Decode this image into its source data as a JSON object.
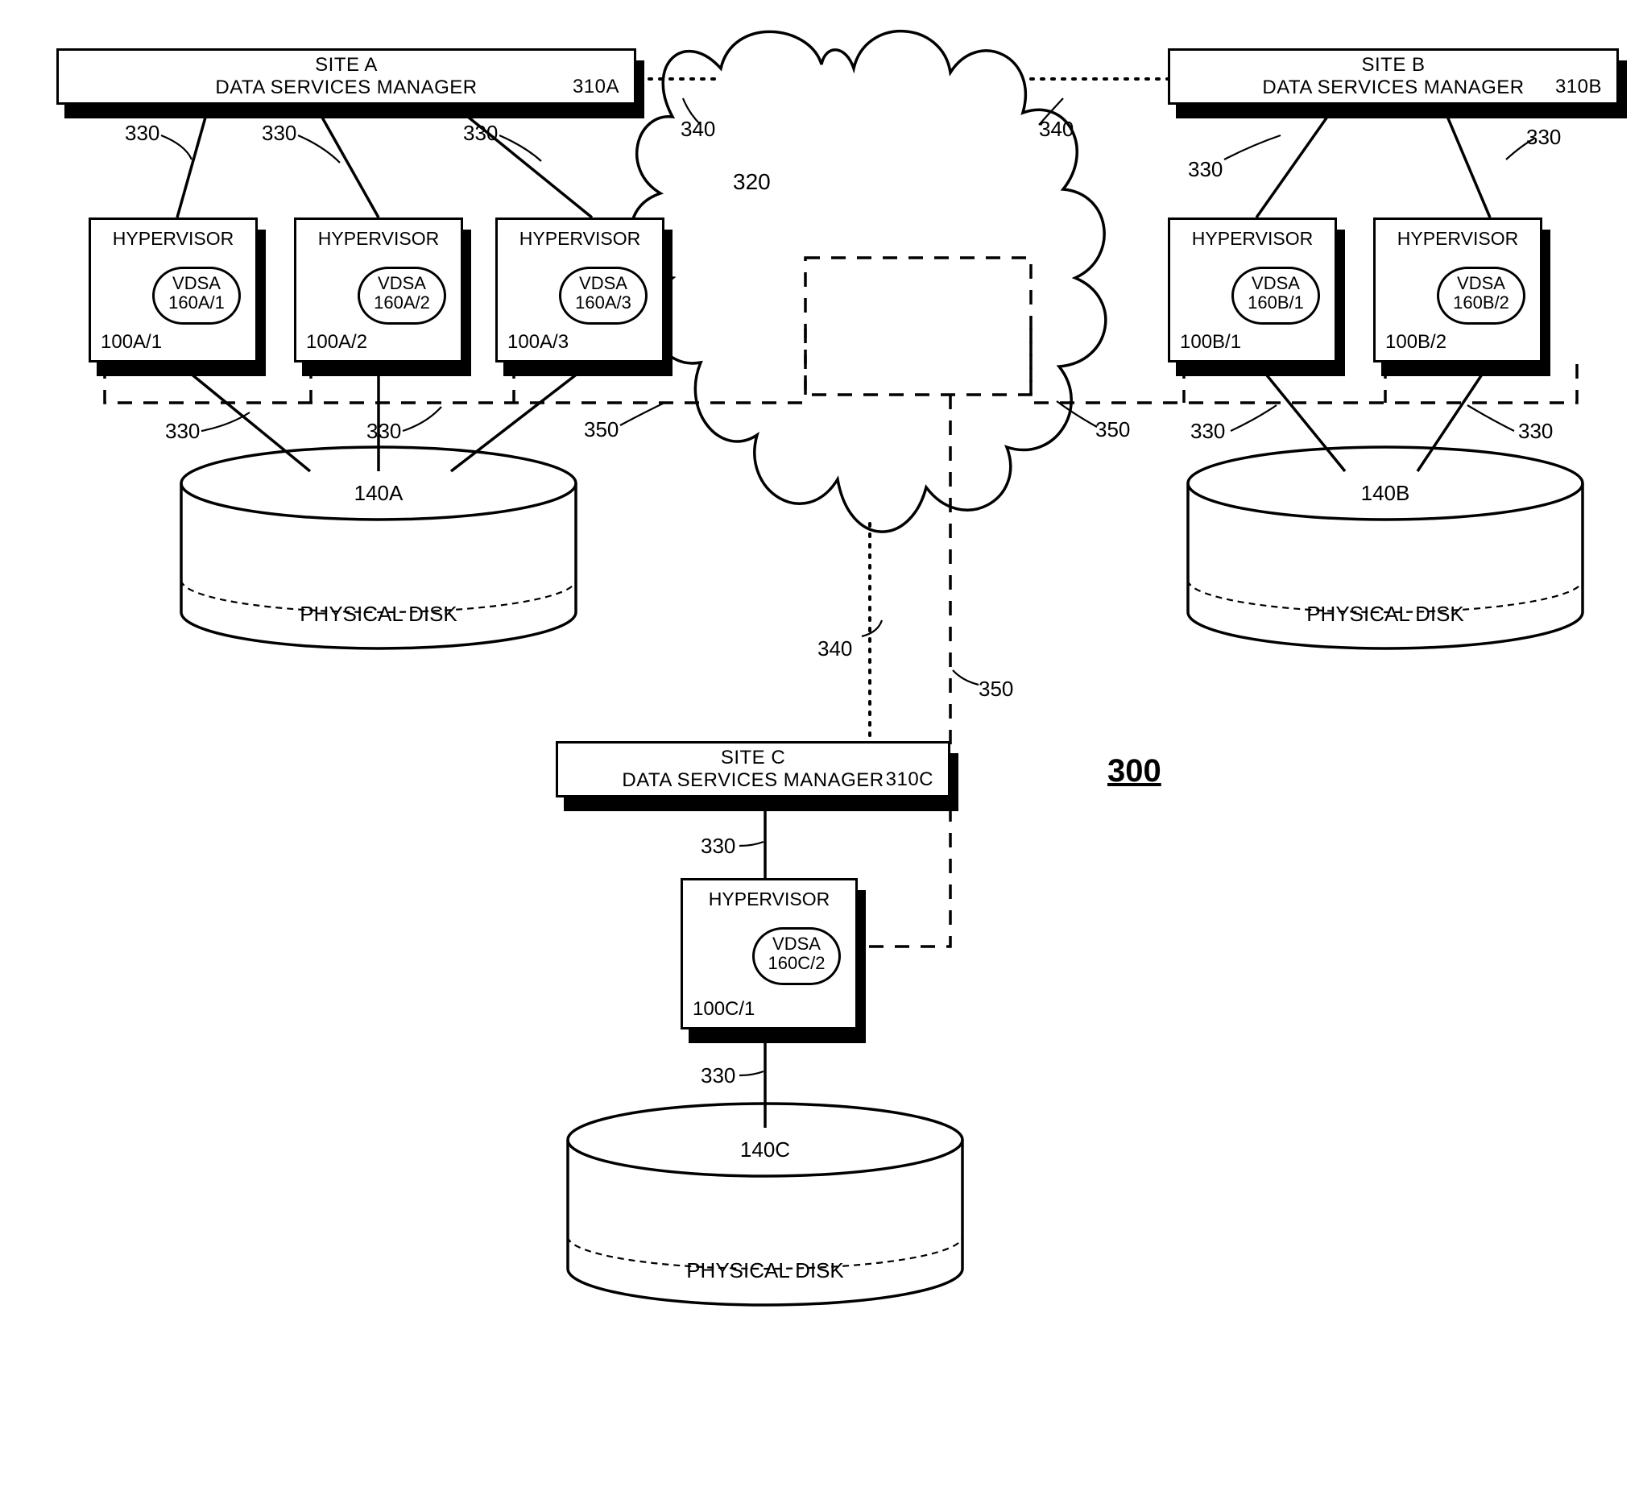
{
  "figure_ref": "300",
  "cloud": {
    "ref": "320"
  },
  "sites": {
    "A": {
      "dsm": {
        "title1": "SITE A",
        "title2": "DATA SERVICES MANAGER",
        "ref": "310A"
      },
      "disk": {
        "ref": "140A",
        "caption": "PHYSICAL DISK"
      },
      "hypervisors": [
        {
          "title": "HYPERVISOR",
          "host_ref": "100A/1",
          "vdsa_label": "VDSA",
          "vdsa_ref": "160A/1"
        },
        {
          "title": "HYPERVISOR",
          "host_ref": "100A/2",
          "vdsa_label": "VDSA",
          "vdsa_ref": "160A/2"
        },
        {
          "title": "HYPERVISOR",
          "host_ref": "100A/3",
          "vdsa_label": "VDSA",
          "vdsa_ref": "160A/3"
        }
      ]
    },
    "B": {
      "dsm": {
        "title1": "SITE B",
        "title2": "DATA SERVICES MANAGER",
        "ref": "310B"
      },
      "disk": {
        "ref": "140B",
        "caption": "PHYSICAL DISK"
      },
      "hypervisors": [
        {
          "title": "HYPERVISOR",
          "host_ref": "100B/1",
          "vdsa_label": "VDSA",
          "vdsa_ref": "160B/1"
        },
        {
          "title": "HYPERVISOR",
          "host_ref": "100B/2",
          "vdsa_label": "VDSA",
          "vdsa_ref": "160B/2"
        }
      ]
    },
    "C": {
      "dsm": {
        "title1": "SITE C",
        "title2": "DATA SERVICES MANAGER",
        "ref": "310C"
      },
      "disk": {
        "ref": "140C",
        "caption": "PHYSICAL DISK"
      },
      "hypervisors": [
        {
          "title": "HYPERVISOR",
          "host_ref": "100C/1",
          "vdsa_label": "VDSA",
          "vdsa_ref": "160C/2"
        }
      ]
    }
  },
  "link_refs": {
    "solid": "330",
    "dotted": "340",
    "dashed": "350"
  },
  "label_instances": {
    "l330_a1": "330",
    "l330_a2": "330",
    "l330_a3": "330",
    "l330_a4": "330",
    "l330_a5": "330",
    "l330_b1": "330",
    "l330_b2": "330",
    "l330_b3": "330",
    "l330_b4": "330",
    "l330_c1": "330",
    "l330_c2": "330",
    "l340_1": "340",
    "l340_2": "340",
    "l340_3": "340",
    "l350_1": "350",
    "l350_2": "350",
    "l350_3": "350"
  }
}
